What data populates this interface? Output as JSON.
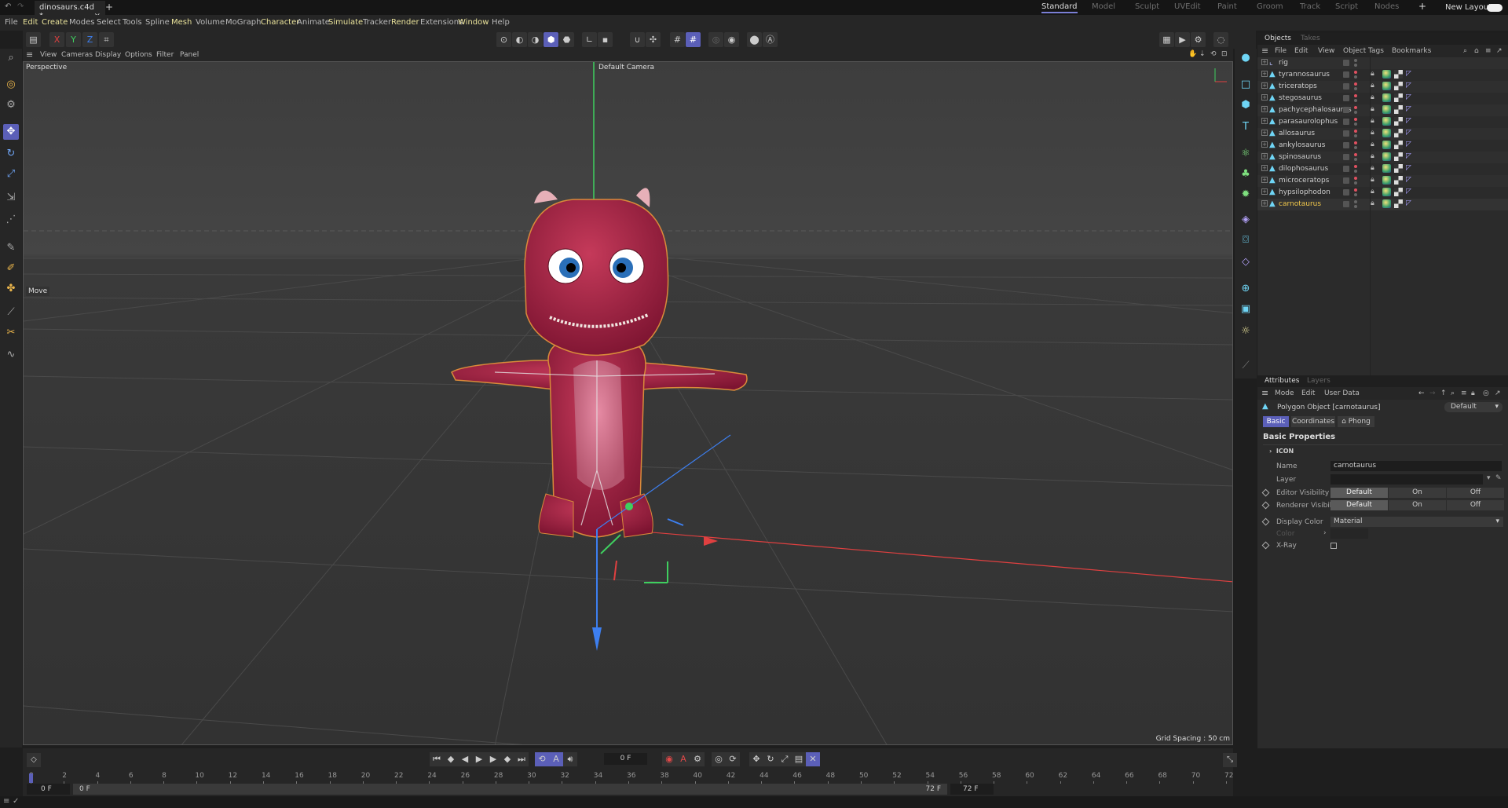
{
  "titlebar": {
    "file_tab": "dinosaurs.c4d *",
    "close": "×",
    "new_tab": "+",
    "layouts": [
      "Standard",
      "Model",
      "Sculpt",
      "UVEdit",
      "Paint",
      "Groom",
      "Track",
      "Script",
      "Nodes"
    ],
    "active_layout": "Standard",
    "add_layout": "+",
    "new_layouts": "New Layouts"
  },
  "menu": [
    "File",
    "Edit",
    "Create",
    "Modes",
    "Select",
    "Tools",
    "Spline",
    "Mesh",
    "Volume",
    "MoGraph",
    "Character",
    "Animate",
    "Simulate",
    "Tracker",
    "Render",
    "Extensions",
    "Window",
    "Help"
  ],
  "highlighted_menus": [
    "Edit",
    "Create",
    "Mesh",
    "Character",
    "Simulate",
    "Render",
    "Window"
  ],
  "toolbar": {
    "axes": [
      "X",
      "Y",
      "Z"
    ]
  },
  "viewport": {
    "menu": [
      "View",
      "Cameras",
      "Display",
      "Options",
      "Filter",
      "Panel"
    ],
    "projection": "Perspective",
    "camera": "Default Camera",
    "tool": "Move",
    "grid_spacing": "Grid Spacing : 50 cm"
  },
  "objects": {
    "tabs": [
      "Objects",
      "Takes"
    ],
    "menu": [
      "File",
      "Edit",
      "View",
      "Object",
      "Tags",
      "Bookmarks"
    ],
    "items": [
      {
        "name": "rig",
        "type": "joint"
      },
      {
        "name": "tyrannosaurus"
      },
      {
        "name": "triceratops"
      },
      {
        "name": "stegosaurus"
      },
      {
        "name": "pachycephalosaurus"
      },
      {
        "name": "parasaurolophus"
      },
      {
        "name": "allosaurus"
      },
      {
        "name": "ankylosaurus"
      },
      {
        "name": "spinosaurus"
      },
      {
        "name": "dilophosaurus"
      },
      {
        "name": "microceratops"
      },
      {
        "name": "hypsilophodon"
      },
      {
        "name": "carnotaurus",
        "selected": true
      }
    ]
  },
  "attributes": {
    "tabs": [
      "Attributes",
      "Layers"
    ],
    "menu": [
      "Mode",
      "Edit",
      "User Data"
    ],
    "object_label": "Polygon Object [carnotaurus]",
    "preset": "Default",
    "subtabs": [
      "Basic",
      "Coordinates",
      "Phong"
    ],
    "active_subtab": "Basic",
    "section": "Basic Properties",
    "icon_group": "ICON",
    "name_label": "Name",
    "name_value": "carnotaurus",
    "layer_label": "Layer",
    "editor_visibility": {
      "label": "Editor Visibility",
      "options": [
        "Default",
        "On",
        "Off"
      ],
      "selected": "Default"
    },
    "renderer_visibility": {
      "label": "Renderer Visibility",
      "options": [
        "Default",
        "On",
        "Off"
      ],
      "selected": "Default"
    },
    "display_color": {
      "label": "Display Color",
      "value": "Material"
    },
    "color_label": "Color",
    "xray_label": "X-Ray",
    "xray_checked": false
  },
  "timeline": {
    "current_frame": "0 F",
    "start": "0 F",
    "range_start": "0 F",
    "range_end": "72 F",
    "end": "72 F",
    "ticks": [
      "0",
      "2",
      "4",
      "6",
      "8",
      "10",
      "12",
      "14",
      "16",
      "18",
      "20",
      "22",
      "24",
      "26",
      "28",
      "30",
      "32",
      "34",
      "36",
      "38",
      "40",
      "42",
      "44",
      "46",
      "48",
      "50",
      "52",
      "54",
      "56",
      "58",
      "60",
      "62",
      "64",
      "66",
      "68",
      "70",
      "72"
    ]
  },
  "colors": {
    "accent": "#5b5fb8",
    "highlight_menu": "#e9e29a",
    "selected_object": "#f2c84b",
    "object_icon": "#6fd5f5",
    "x_axis": "#e04040",
    "y_axis": "#3fcf5f",
    "z_axis": "#3d7ff0"
  }
}
